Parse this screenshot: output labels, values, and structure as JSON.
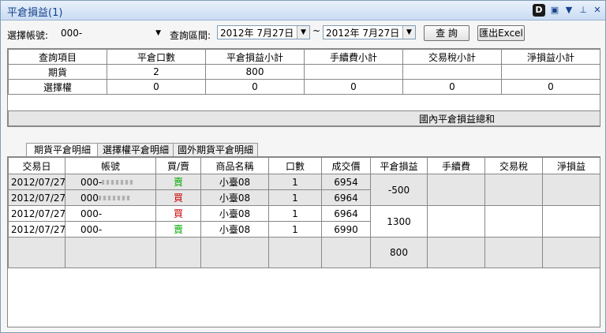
{
  "window": {
    "title": "平倉損益(1)"
  },
  "titlebar_icons": [
    "d-logo-icon",
    "new-window-icon",
    "dropdown-icon",
    "pin-icon",
    "close-icon"
  ],
  "toolbar": {
    "account_label": "選擇帳號:",
    "account_value": "000-",
    "range_label": "查詢區間:",
    "date_from": "2012年  7月27日",
    "range_sep": "~",
    "date_to": "2012年  7月27日",
    "query_button": "查 詢",
    "export_button": "匯出Excel"
  },
  "summary": {
    "headers": [
      "查詢項目",
      "平倉口數",
      "平倉損益小計",
      "手續費小計",
      "交易稅小計",
      "淨損益小計"
    ],
    "rows": [
      [
        "期貨",
        "2",
        "800",
        "",
        "",
        ""
      ],
      [
        "選擇權",
        "0",
        "0",
        "0",
        "0",
        "0"
      ]
    ],
    "total_label": "國內平倉損益總和"
  },
  "tabs": [
    "期貨平倉明細",
    "選擇權平倉明細",
    "國外期貨平倉明細"
  ],
  "detail": {
    "headers": [
      "交易日",
      "帳號",
      "買/賣",
      "商品名稱",
      "口數",
      "成交價",
      "平倉損益",
      "手續費",
      "交易稅",
      "淨損益"
    ],
    "rows": [
      {
        "date": "2012/07/27",
        "account": "000-",
        "side": "賣",
        "product": "小臺08",
        "qty": "1",
        "price": "6954"
      },
      {
        "date": "2012/07/27",
        "account": "000",
        "side": "買",
        "product": "小臺08",
        "qty": "1",
        "price": "6964"
      },
      {
        "date": "2012/07/27",
        "account": "000-",
        "side": "買",
        "product": "小臺08",
        "qty": "1",
        "price": "6964"
      },
      {
        "date": "2012/07/27",
        "account": "000-",
        "side": "賣",
        "product": "小臺08",
        "qty": "1",
        "price": "6990"
      }
    ],
    "pnl_groups": [
      "-500",
      "1300"
    ],
    "total_pnl": "800"
  }
}
